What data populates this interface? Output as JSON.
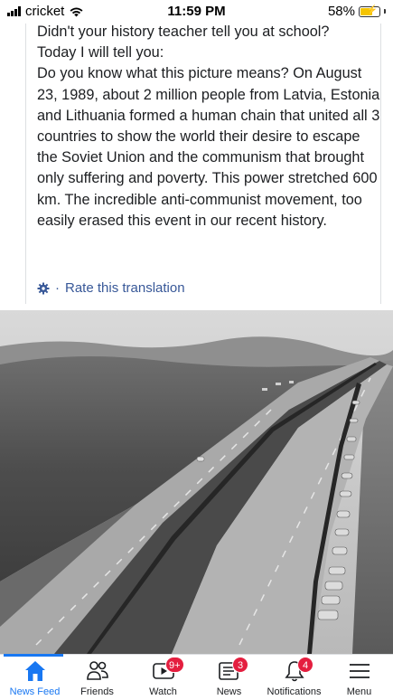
{
  "status_bar": {
    "carrier": "cricket",
    "time": "11:59 PM",
    "battery": "58%",
    "battery_level": 0.58
  },
  "post": {
    "text": "Didn't your history teacher tell you at school?\nToday I will tell you:\nDo you know what this picture means? On August 23, 1989, about 2 million people from Latvia, Estonia and Lithuania formed a human chain that united all 3 countries to show the world their desire to escape the Soviet Union and the communism that brought only suffering and poverty. This power stretched 600 km. The incredible anti-communist movement, too easily erased this event in our recent history.",
    "separator": "·",
    "translation_link": "Rate this translation",
    "photo_icon": "photo-icon"
  },
  "nav": {
    "items": [
      {
        "label": "News Feed",
        "icon": "home-icon",
        "active": true
      },
      {
        "label": "Friends",
        "icon": "friends-icon"
      },
      {
        "label": "Watch",
        "icon": "watch-icon",
        "badge": "9+"
      },
      {
        "label": "News",
        "icon": "news-icon",
        "badge": "3"
      },
      {
        "label": "Notifications",
        "icon": "bell-icon",
        "badge": "4"
      },
      {
        "label": "Menu",
        "icon": "menu-icon"
      }
    ]
  },
  "colors": {
    "accent": "#1877f2",
    "link": "#385898",
    "badge": "#e41e3f"
  }
}
